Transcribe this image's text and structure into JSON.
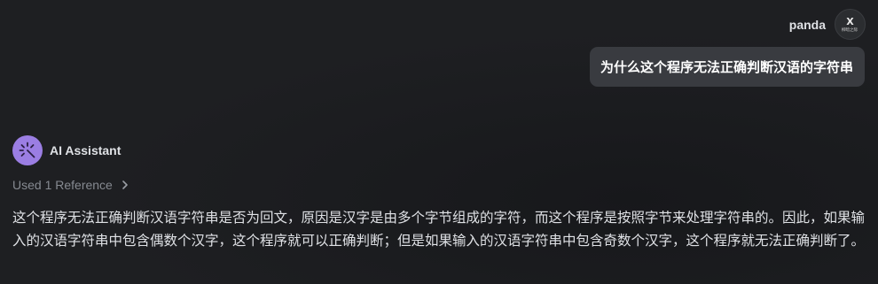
{
  "user": {
    "name": "panda",
    "avatar_glyph": "X",
    "avatar_caption": "柳暗之际",
    "message": "为什么这个程序无法正确判断汉语的字符串"
  },
  "assistant": {
    "name": "AI Assistant",
    "avatar_icon": "sparkle-wand-icon",
    "references_label": "Used 1 Reference",
    "answer": "这个程序无法正确判断汉语字符串是否为回文，原因是汉字是由多个字节组成的字符，而这个程序是按照字节来处理字符串的。因此，如果输入的汉语字符串中包含偶数个汉字，这个程序就可以正确判断；但是如果输入的汉语字符串中包含奇数个汉字，这个程序就无法正确判断了。"
  },
  "colors": {
    "background": "#1e1f22",
    "user_bubble": "#393b40",
    "assistant_avatar": "#9b7ee3",
    "muted_text": "#868a91",
    "text": "#dfe1e5"
  }
}
